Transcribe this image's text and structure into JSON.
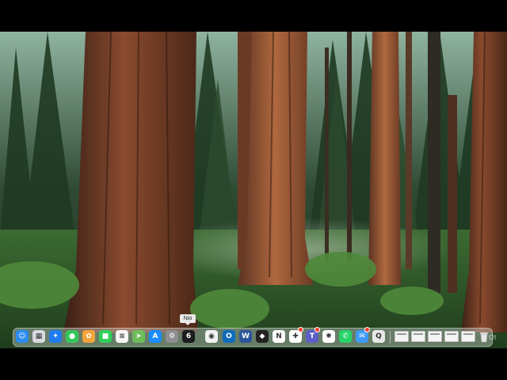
{
  "desktop": {
    "wallpaper": "giant sequoia forest"
  },
  "dock": {
    "tooltip": "Nio",
    "apps": [
      {
        "name": "Finder",
        "icon": "finder-icon",
        "color": "#2a8bf2",
        "glyph": "☺"
      },
      {
        "name": "Launchpad",
        "icon": "launchpad-icon",
        "color": "#d9d9e0",
        "glyph": "▦"
      },
      {
        "name": "Safari",
        "icon": "safari-icon",
        "color": "#1e7cf0",
        "glyph": "✦"
      },
      {
        "name": "Messages",
        "icon": "messages-icon",
        "color": "#34c759",
        "glyph": "●"
      },
      {
        "name": "Photos",
        "icon": "photos-icon",
        "color": "#f2a33a",
        "glyph": "✿"
      },
      {
        "name": "FaceTime",
        "icon": "facetime-icon",
        "color": "#30d158",
        "glyph": "■"
      },
      {
        "name": "Reminders",
        "icon": "reminders-icon",
        "color": "#f5f5f5",
        "glyph": "≡"
      },
      {
        "name": "Maps",
        "icon": "maps-icon",
        "color": "#6dbd5b",
        "glyph": "➤"
      },
      {
        "name": "App Store",
        "icon": "app-store-icon",
        "color": "#1a8cff",
        "glyph": "A"
      },
      {
        "name": "System Settings",
        "icon": "settings-icon",
        "color": "#8e8e93",
        "glyph": "⚙"
      },
      {
        "name": "Nio",
        "icon": "nio-icon",
        "color": "#1c1c1e",
        "glyph": "6"
      },
      {
        "name": "Chrome",
        "icon": "chrome-icon",
        "color": "#f2f2f2",
        "glyph": "◉"
      },
      {
        "name": "Outlook",
        "icon": "outlook-icon",
        "color": "#0f6cbd",
        "glyph": "O"
      },
      {
        "name": "Word",
        "icon": "word-icon",
        "color": "#2b579a",
        "glyph": "W"
      },
      {
        "name": "Sketch",
        "icon": "sketch-icon",
        "color": "#222222",
        "glyph": "◆"
      },
      {
        "name": "Notion",
        "icon": "notion-icon",
        "color": "#ffffff",
        "glyph": "N"
      },
      {
        "name": "Slack",
        "icon": "slack-icon",
        "color": "#ffffff",
        "glyph": "✚"
      },
      {
        "name": "Teams",
        "icon": "teams-icon",
        "color": "#5b5fc7",
        "glyph": "T"
      },
      {
        "name": "ChatGPT",
        "icon": "chatgpt-icon",
        "color": "#ffffff",
        "glyph": "✺"
      },
      {
        "name": "WhatsApp",
        "icon": "whatsapp-icon",
        "color": "#25d366",
        "glyph": "✆"
      },
      {
        "name": "Mail",
        "icon": "mail-icon",
        "color": "#3d9bf5",
        "glyph": "✉"
      },
      {
        "name": "QuickTime",
        "icon": "quicktime-icon",
        "color": "#e8e8e8",
        "glyph": "Q"
      }
    ],
    "windows": [
      "Window",
      "Window",
      "Window",
      "Window",
      "Window"
    ],
    "trash": {
      "name": "Trash",
      "icon": "trash-icon"
    }
  },
  "watermark": "Ot"
}
